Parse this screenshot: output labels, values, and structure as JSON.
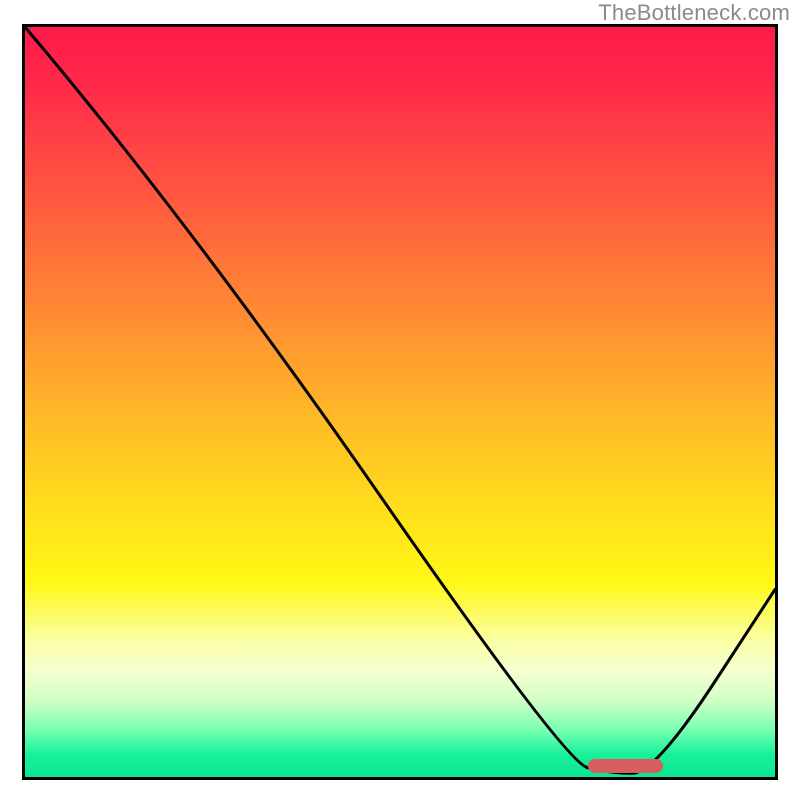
{
  "attribution": "TheBottleneck.com",
  "chart_data": {
    "type": "line",
    "title": "",
    "xlabel": "",
    "ylabel": "",
    "xlim": [
      0,
      100
    ],
    "ylim": [
      0,
      100
    ],
    "curve": [
      {
        "x": 0,
        "y": 100
      },
      {
        "x": 22,
        "y": 74
      },
      {
        "x": 72,
        "y": 2
      },
      {
        "x": 78,
        "y": 0.5
      },
      {
        "x": 84,
        "y": 0.5
      },
      {
        "x": 100,
        "y": 25
      }
    ],
    "optimal_range": {
      "start": 75,
      "end": 85,
      "y": 1.5
    },
    "gradient_stops": [
      {
        "pos": 0,
        "color": "#ff1a4a"
      },
      {
        "pos": 50,
        "color": "#ffc020"
      },
      {
        "pos": 80,
        "color": "#fff815"
      },
      {
        "pos": 100,
        "color": "#0be592"
      }
    ]
  }
}
